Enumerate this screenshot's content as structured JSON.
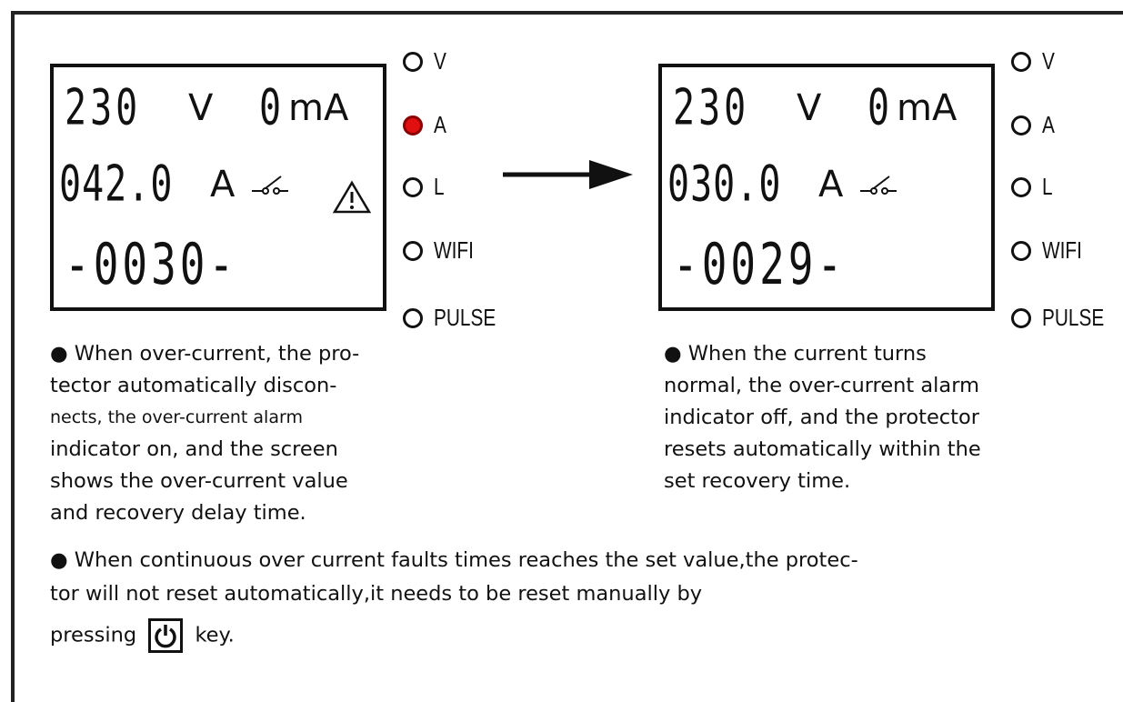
{
  "left": {
    "voltage": "230",
    "voltage_unit": "V",
    "leak": "0",
    "leak_unit": "mA",
    "current": "042.0",
    "current_unit": "A",
    "count": "-0030-",
    "alarm_icon": "warning-triangle-icon",
    "switch_icon": "breaker-open-icon",
    "indicators": [
      {
        "label": "V",
        "on": false
      },
      {
        "label": "A",
        "on": true
      },
      {
        "label": "L",
        "on": false
      },
      {
        "label": "WIFI",
        "on": false
      },
      {
        "label": "PULSE",
        "on": false
      }
    ],
    "desc_lines": [
      "● When over-current, the pro-",
      "tector automatically discon-",
      "nects, the over-current alarm",
      "indicator on, and the screen",
      "shows the over-current value",
      "and recovery delay time."
    ]
  },
  "right": {
    "voltage": "230",
    "voltage_unit": "V",
    "leak": "0",
    "leak_unit": "mA",
    "current": "030.0",
    "current_unit": "A",
    "count": "-0029-",
    "switch_icon": "breaker-open-icon",
    "indicators": [
      {
        "label": "V",
        "on": false
      },
      {
        "label": "A",
        "on": false
      },
      {
        "label": "L",
        "on": false
      },
      {
        "label": "WIFI",
        "on": false
      },
      {
        "label": "PULSE",
        "on": false
      }
    ],
    "desc_lines": [
      "● When the current turns",
      "normal, the over-current alarm",
      "indicator off, and the protector",
      "resets automatically within the",
      "set recovery time."
    ]
  },
  "arrow_icon": "right-arrow-icon",
  "bottom": {
    "line1": "● When continuous over current faults times reaches the set value,the protec-",
    "line2": "tor will not reset automatically,it needs to be reset manually by",
    "line3_before": "pressing",
    "line3_after": "key.",
    "key_icon": "power-icon"
  },
  "colors": {
    "alarm_red": "#e01010",
    "ink": "#111111"
  }
}
